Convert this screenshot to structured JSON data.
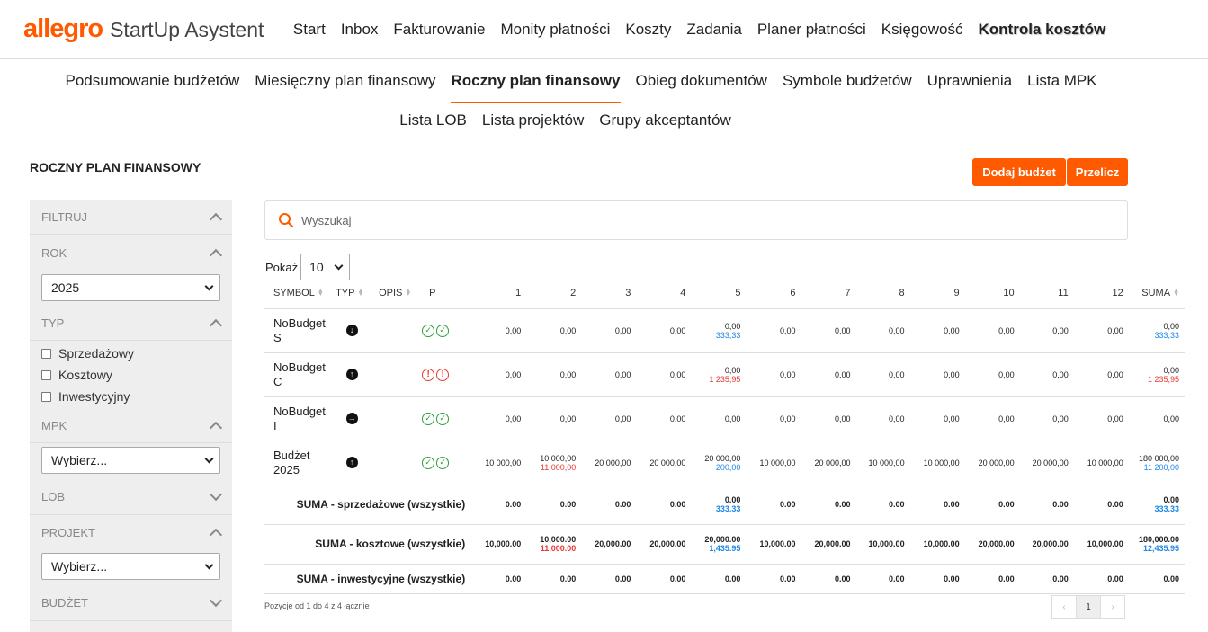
{
  "header": {
    "brand": "allegro",
    "app_name": "StartUp Asystent",
    "nav": [
      "Start",
      "Inbox",
      "Fakturowanie",
      "Monity płatności",
      "Koszty",
      "Zadania",
      "Planer płatności",
      "Księgowość",
      "Kontrola kosztów"
    ],
    "active_nav": "Kontrola kosztów"
  },
  "subnav": {
    "row1": [
      "Podsumowanie budżetów",
      "Miesięczny plan finansowy",
      "Roczny plan finansowy",
      "Obieg dokumentów",
      "Symbole budżetów",
      "Uprawnienia",
      "Lista MPK"
    ],
    "row2": [
      "Lista LOB",
      "Lista projektów",
      "Grupy akceptantów"
    ],
    "active": "Roczny plan finansowy"
  },
  "page": {
    "title": "ROCZNY PLAN FINANSOWY",
    "add_button": "Dodaj budżet",
    "calc_button": "Przelicz"
  },
  "filters": {
    "title": "FILTRUJ",
    "rok_label": "ROK",
    "rok_value": "2025",
    "typ_label": "TYP",
    "typ_options": [
      "Sprzedażowy",
      "Kosztowy",
      "Inwestycyjny"
    ],
    "mpk_label": "MPK",
    "mpk_value": "Wybierz...",
    "lob_label": "LOB",
    "projekt_label": "PROJEKT",
    "projekt_value": "Wybierz...",
    "budzet_label": "BUDŻET"
  },
  "search": {
    "placeholder": "Wyszukaj"
  },
  "pagesize": {
    "label": "Pokaż",
    "value": "10"
  },
  "table": {
    "headers": [
      "SYMBOL",
      "TYP",
      "OPIS",
      "P",
      "1",
      "2",
      "3",
      "4",
      "5",
      "6",
      "7",
      "8",
      "9",
      "10",
      "11",
      "12",
      "SUMA"
    ],
    "rows": [
      {
        "symbol": "NoBudget S",
        "typ_icon": "arrow-down-icon",
        "p": "ok",
        "cells": [
          [
            "0,00"
          ],
          [
            "0,00"
          ],
          [
            "0,00"
          ],
          [
            "0,00"
          ],
          [
            "0,00",
            "333,33",
            "blue"
          ],
          [
            "0,00"
          ],
          [
            "0,00"
          ],
          [
            "0,00"
          ],
          [
            "0,00"
          ],
          [
            "0,00"
          ],
          [
            "0,00"
          ],
          [
            "0,00"
          ],
          [
            "0,00",
            "333,33",
            "blue"
          ]
        ]
      },
      {
        "symbol": "NoBudget C",
        "typ_icon": "arrow-up-icon",
        "p": "err",
        "cells": [
          [
            "0,00"
          ],
          [
            "0,00"
          ],
          [
            "0,00"
          ],
          [
            "0,00"
          ],
          [
            "0,00",
            "1 235,95",
            "red"
          ],
          [
            "0,00"
          ],
          [
            "0,00"
          ],
          [
            "0,00"
          ],
          [
            "0,00"
          ],
          [
            "0,00"
          ],
          [
            "0,00"
          ],
          [
            "0,00"
          ],
          [
            "0,00",
            "1 235,95",
            "red"
          ]
        ]
      },
      {
        "symbol": "NoBudget I",
        "typ_icon": "arrow-right-icon",
        "p": "ok",
        "cells": [
          [
            "0,00"
          ],
          [
            "0,00"
          ],
          [
            "0,00"
          ],
          [
            "0,00"
          ],
          [
            "0,00"
          ],
          [
            "0,00"
          ],
          [
            "0,00"
          ],
          [
            "0,00"
          ],
          [
            "0,00"
          ],
          [
            "0,00"
          ],
          [
            "0,00"
          ],
          [
            "0,00"
          ],
          [
            "0,00"
          ]
        ]
      },
      {
        "symbol": "Budżet 2025",
        "typ_icon": "arrow-up-icon",
        "p": "ok",
        "cells": [
          [
            "10 000,00"
          ],
          [
            "10 000,00",
            "11 000,00",
            "red"
          ],
          [
            "20 000,00"
          ],
          [
            "20 000,00"
          ],
          [
            "20 000,00",
            "200,00",
            "blue"
          ],
          [
            "10 000,00"
          ],
          [
            "20 000,00"
          ],
          [
            "10 000,00"
          ],
          [
            "10 000,00"
          ],
          [
            "20 000,00"
          ],
          [
            "20 000,00"
          ],
          [
            "10 000,00"
          ],
          [
            "180 000,00",
            "11 200,00",
            "blue"
          ]
        ]
      }
    ],
    "sums": [
      {
        "label": "SUMA - sprzedażowe (wszystkie)",
        "cells": [
          [
            "0.00"
          ],
          [
            "0.00"
          ],
          [
            "0.00"
          ],
          [
            "0.00"
          ],
          [
            "0.00",
            "333.33",
            "blue"
          ],
          [
            "0.00"
          ],
          [
            "0.00"
          ],
          [
            "0.00"
          ],
          [
            "0.00"
          ],
          [
            "0.00"
          ],
          [
            "0.00"
          ],
          [
            "0.00"
          ],
          [
            "0.00",
            "333.33",
            "blue"
          ]
        ]
      },
      {
        "label": "SUMA - kosztowe (wszystkie)",
        "cells": [
          [
            "10,000.00"
          ],
          [
            "10,000.00",
            "11,000.00",
            "red"
          ],
          [
            "20,000.00"
          ],
          [
            "20,000.00"
          ],
          [
            "20,000.00",
            "1,435.95",
            "blue"
          ],
          [
            "10,000.00"
          ],
          [
            "20,000.00"
          ],
          [
            "10,000.00"
          ],
          [
            "10,000.00"
          ],
          [
            "20,000.00"
          ],
          [
            "20,000.00"
          ],
          [
            "10,000.00"
          ],
          [
            "180,000.00",
            "12,435.95",
            "blue"
          ]
        ]
      },
      {
        "label": "SUMA - inwestycyjne (wszystkie)",
        "cells": [
          [
            "0.00"
          ],
          [
            "0.00"
          ],
          [
            "0.00"
          ],
          [
            "0.00"
          ],
          [
            "0.00"
          ],
          [
            "0.00"
          ],
          [
            "0.00"
          ],
          [
            "0.00"
          ],
          [
            "0.00"
          ],
          [
            "0.00"
          ],
          [
            "0.00"
          ],
          [
            "0.00"
          ],
          [
            "0.00"
          ]
        ]
      }
    ]
  },
  "footer": {
    "info": "Pozycje od 1 do 4 z 4 łącznie",
    "prev": "‹",
    "current_page": "1",
    "next": "›"
  }
}
